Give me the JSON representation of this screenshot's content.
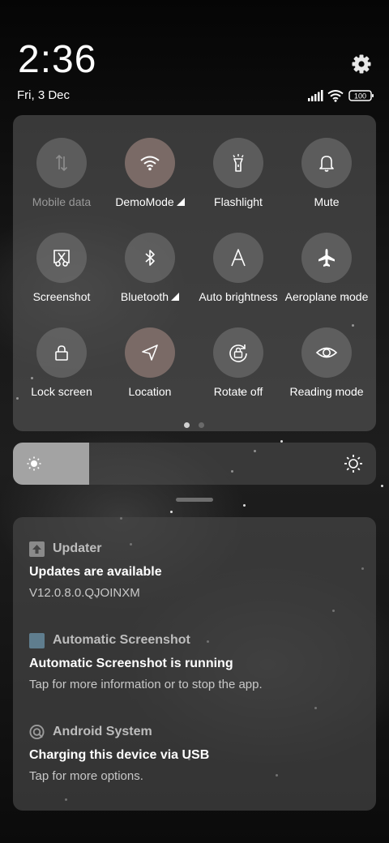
{
  "status_bar": {
    "time": "2:36",
    "date": "Fri, 3 Dec",
    "battery": "100",
    "icons": [
      "signal-icon",
      "wifi-icon",
      "battery-icon"
    ]
  },
  "settings_icon": "gear-icon",
  "quick_settings": {
    "tiles": [
      {
        "label": "Mobile data",
        "icon": "mobile-data-icon",
        "active": false,
        "disabled": true
      },
      {
        "label": "DemoMode",
        "icon": "wifi-icon",
        "active": true,
        "expandable": true
      },
      {
        "label": "Flashlight",
        "icon": "flashlight-icon",
        "active": false
      },
      {
        "label": "Mute",
        "icon": "bell-icon",
        "active": false
      },
      {
        "label": "Screenshot",
        "icon": "screenshot-icon",
        "active": false
      },
      {
        "label": "Bluetooth",
        "icon": "bluetooth-icon",
        "active": false,
        "expandable": true
      },
      {
        "label": "Auto brightness",
        "icon": "auto-brightness-icon",
        "active": false
      },
      {
        "label": "Aeroplane mode",
        "icon": "airplane-icon",
        "active": false
      },
      {
        "label": "Lock screen",
        "icon": "lock-icon",
        "active": false
      },
      {
        "label": "Location",
        "icon": "location-icon",
        "active": true
      },
      {
        "label": "Rotate off",
        "icon": "rotate-lock-icon",
        "active": false
      },
      {
        "label": "Reading mode",
        "icon": "eye-icon",
        "active": false
      }
    ],
    "pages": 2,
    "current_page": 1
  },
  "brightness": {
    "level": 0.21,
    "icons": [
      "brightness-low-icon",
      "brightness-high-icon"
    ]
  },
  "notifications": [
    {
      "app": "Updater",
      "icon": "updater-icon",
      "title": "Updates are available",
      "body": "V12.0.8.0.QJOINXM"
    },
    {
      "app": "Automatic Screenshot",
      "icon": "screenshot-app-icon",
      "title": "Automatic Screenshot is running",
      "body": "Tap for more information or to stop the app."
    },
    {
      "app": "Android System",
      "icon": "android-system-icon",
      "title": "Charging this device via USB",
      "body": "Tap for more options."
    }
  ],
  "colors": {
    "tile_active": "#7a6a66",
    "tile_inactive": "#787878",
    "brightness_fill": "#a3a3a3",
    "screenshot_app_icon": "#5f7d8e"
  }
}
